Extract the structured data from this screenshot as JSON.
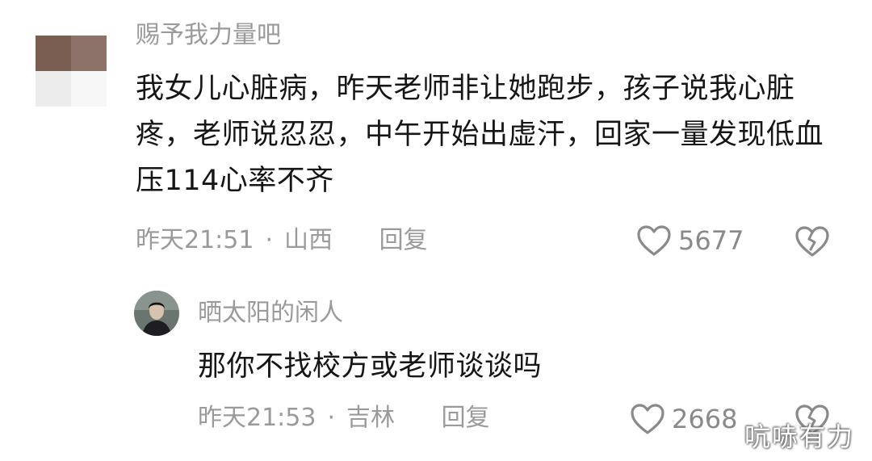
{
  "comments": [
    {
      "username": "赐予我力量吧",
      "text": "我女儿心脏病，昨天老师非让她跑步，孩子说我心脏疼，老师说忍忍，中午开始出虚汗，回家一量发现低血压114心率不齐",
      "time": "昨天21:51",
      "separator": "·",
      "location": "山西",
      "reply_label": "回复",
      "like_count": "5677"
    },
    {
      "username": "晒太阳的闲人",
      "text": "那你不找校方或老师谈谈吗",
      "time": "昨天21:53",
      "separator": "·",
      "location": "吉林",
      "reply_label": "回复",
      "like_count": "2668"
    }
  ],
  "watermark": "吭哧有力",
  "icons": {
    "like": "heart-outline-icon",
    "dislike": "broken-heart-icon"
  }
}
